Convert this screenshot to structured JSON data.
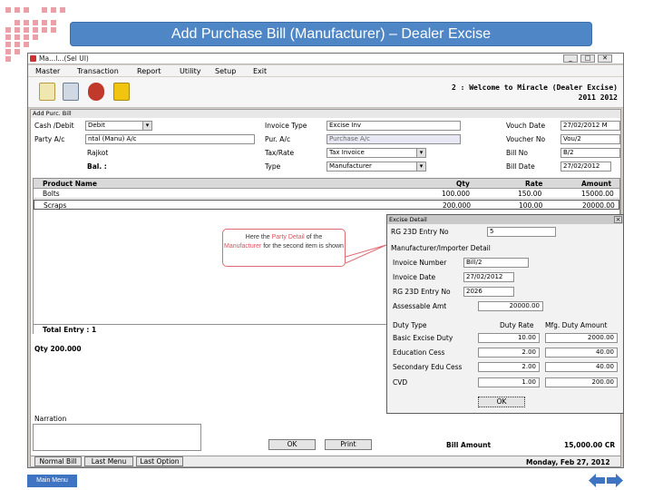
{
  "slide": {
    "title": "Add Purchase Bill (Manufacturer) – Dealer Excise",
    "main_menu_label": "Main Menu"
  },
  "window": {
    "title": "Ma...l...(Sel UI)",
    "min": "_",
    "max": "□",
    "close": "✕"
  },
  "menu": [
    "Master",
    "Transaction",
    "Report",
    "Utility",
    "Setup",
    "Exit"
  ],
  "welcome": {
    "line1": "2 : Welcome to Miracle (Dealer Excise)",
    "line2": "2011 2012"
  },
  "form": {
    "title": "Add Purc. Bill",
    "cash_debit_label": "Cash /Debit",
    "cash_debit_value": "Debit",
    "party_label": "Party A/c",
    "party_value": "ntal (Manu) A/c",
    "city": "Rajkot",
    "bal_label": "Bal. :",
    "invoice_type_label": "Invoice Type",
    "invoice_type_value": "Excise Inv",
    "pur_ac_label": "Pur. A/c",
    "pur_ac_value": "Purchase A/c",
    "tax_rate_label": "Tax/Rate",
    "tax_rate_value": "Tax Invoice",
    "type_label": "Type",
    "type_value": "Manufacturer",
    "vouch_date_label": "Vouch Date",
    "vouch_date_value": "27/02/2012 M",
    "vouch_no_label": "Voucher No",
    "vouch_no_value": "Vou/2",
    "bill_no_label": "Bill No",
    "bill_no_value": "B/2",
    "bill_date_label": "Bill Date",
    "bill_date_value": "27/02/2012"
  },
  "grid": {
    "headers": [
      "Product Name",
      "Qty",
      "Rate",
      "Amount"
    ],
    "rows": [
      [
        "Bolts",
        "100.000",
        "150.00",
        "15000.00"
      ],
      [
        "Scraps",
        "200.000",
        "100.00",
        "20000.00"
      ]
    ],
    "total_entry": "Total Entry : 1",
    "qty_total": "Qty 200.000"
  },
  "bottom": {
    "narration_label": "Narration",
    "ok": "OK",
    "print": "Print",
    "bill_amount_label": "Bill Amount",
    "bill_amount_value": "15,000.00 CR",
    "status_tabs": [
      "Normal Bill",
      "Last Menu",
      "Last Option"
    ],
    "status_date": "Monday, Feb 27, 2012"
  },
  "dialog": {
    "title": "Excise Detail",
    "rg23d_label": "RG 23D Entry No",
    "rg23d_value": "5",
    "section": "Manufacturer/Importer Detail",
    "invoice_number_label": "Invoice Number",
    "invoice_number_value": "Bill/2",
    "invoice_date_label": "Invoice Date",
    "invoice_date_value": "27/02/2012",
    "rg23d_no_label": "RG 23D Entry No",
    "rg23d_no_value": "2026",
    "assessable_label": "Assessable Amt",
    "assessable_value": "20000.00",
    "duty_type_label": "Duty Type",
    "duty_rate_label": "Duty Rate",
    "mfg_duty_label": "Mfg. Duty Amount",
    "duties": [
      {
        "name": "Basic Excise Duty",
        "rate": "10.00",
        "amount": "2000.00"
      },
      {
        "name": "Education Cess",
        "rate": "2.00",
        "amount": "40.00"
      },
      {
        "name": "Secondary Edu Cess",
        "rate": "2.00",
        "amount": "40.00"
      },
      {
        "name": "CVD",
        "rate": "1.00",
        "amount": "200.00"
      }
    ],
    "ok": "OK"
  },
  "callout": {
    "part1": "Here the ",
    "highlight1": "Party Detail",
    "part2": " of the ",
    "highlight2": "Manufacturer",
    "part3": " for the second item is shown"
  },
  "colors": {
    "banner": "#4f86c6",
    "accent": "#e54c5a",
    "window_bg": "#d4d0c8"
  }
}
